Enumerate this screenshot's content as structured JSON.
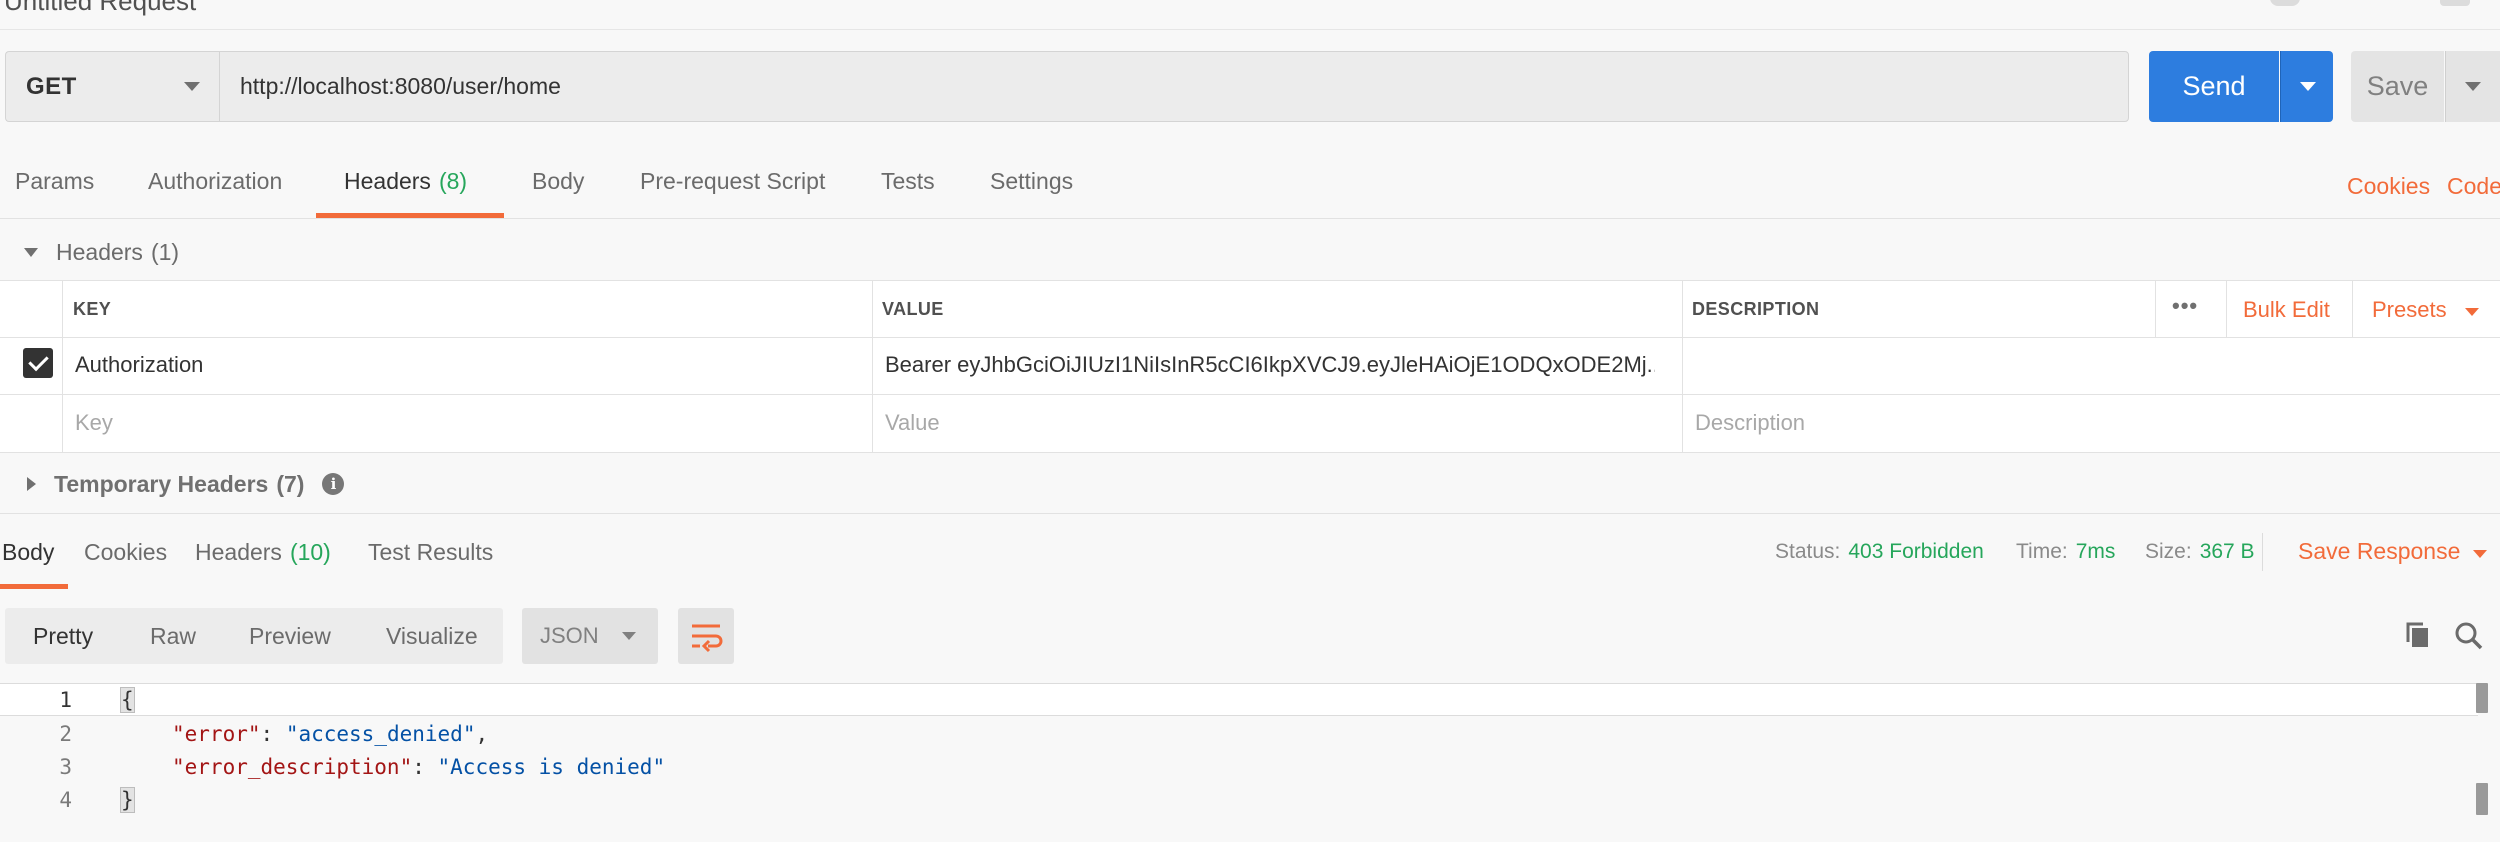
{
  "request": {
    "title": "Untitled Request",
    "method": "GET",
    "url": "http://localhost:8080/user/home",
    "send_label": "Send",
    "save_label": "Save"
  },
  "request_tabs": {
    "params": "Params",
    "authorization": "Authorization",
    "headers": "Headers",
    "headers_count": "(8)",
    "body": "Body",
    "pre_request_script": "Pre-request Script",
    "tests": "Tests",
    "settings": "Settings",
    "cookies_link": "Cookies",
    "code_link": "Code"
  },
  "headers_section": {
    "title": "Headers",
    "count": "(1)",
    "columns": {
      "key": "KEY",
      "value": "VALUE",
      "description": "DESCRIPTION"
    },
    "more_icon": "•••",
    "bulk_edit": "Bulk Edit",
    "presets": "Presets",
    "rows": [
      {
        "enabled": true,
        "key": "Authorization",
        "value": "Bearer eyJhbGciOiJIUzI1NiIsInR5cCI6IkpXVCJ9.eyJleHAiOjE1ODQxODE2Mj...",
        "description": ""
      }
    ],
    "placeholders": {
      "key": "Key",
      "value": "Value",
      "description": "Description"
    }
  },
  "temporary_headers": {
    "title": "Temporary Headers",
    "count": "(7)",
    "info_icon": "i"
  },
  "response": {
    "tabs": {
      "body": "Body",
      "cookies": "Cookies",
      "headers": "Headers",
      "headers_count": "(10)",
      "test_results": "Test Results"
    },
    "status_label": "Status:",
    "status_value": "403 Forbidden",
    "time_label": "Time:",
    "time_value": "7ms",
    "size_label": "Size:",
    "size_value": "367 B",
    "save_response": "Save Response",
    "views": [
      "Pretty",
      "Raw",
      "Preview",
      "Visualize"
    ],
    "active_view": "Pretty",
    "format": "JSON"
  },
  "code": {
    "line_numbers": [
      "1",
      "2",
      "3",
      "4"
    ],
    "open_brace": "{",
    "close_brace": "}",
    "key1": "\"error\"",
    "val1": "\"access_denied\"",
    "key2": "\"error_description\"",
    "val2": "\"Access is denied\"",
    "colon": ": ",
    "comma": ","
  },
  "colors": {
    "accent_orange": "#f26b3a",
    "send_blue": "#2d7ddf",
    "status_green": "#26a65b"
  },
  "icons": {
    "method_caret": "chevron-down-icon",
    "copy": "copy-icon",
    "search": "search-icon",
    "wrap": "wrap-lines-icon"
  }
}
